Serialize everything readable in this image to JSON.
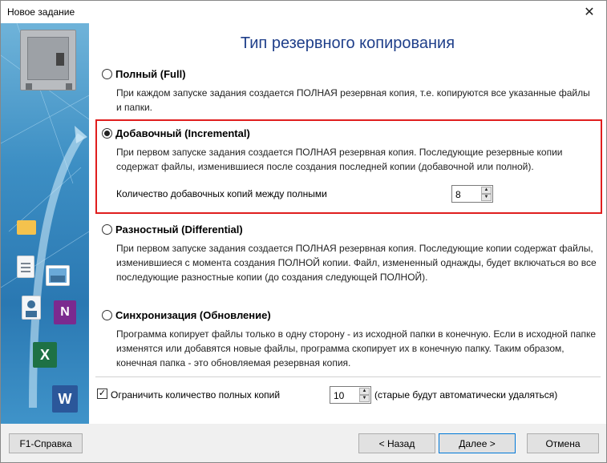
{
  "window": {
    "title": "Новое задание"
  },
  "heading": "Тип резервного копирования",
  "options": [
    {
      "label": "Полный (Full)",
      "description": "При каждом запуске задания создается ПОЛНАЯ резервная копия, т.е. копируются все указанные файлы и папки.",
      "selected": false
    },
    {
      "label": "Добавочный (Incremental)",
      "description": "При первом запуске задания создается ПОЛНАЯ резервная копия. Последующие резервные копии содержат файлы, изменившиеся после создания последней копии (добавочной или полной).",
      "selected": true
    },
    {
      "label": "Разностный (Differential)",
      "description": "При первом запуске задания создается ПОЛНАЯ резервная копия. Последующие копии содержат файлы, изменившиеся с момента создания ПОЛНОЙ копии. Файл, измененный однажды, будет включаться во все последующие разностные копии (до создания следующей ПОЛНОЙ).",
      "selected": false
    },
    {
      "label": "Синхронизация (Обновление)",
      "description": "Программа копирует файлы только в одну сторону - из исходной папки в конечную. Если в исходной папке изменятся или добавятся новые файлы, программа скопирует их в конечную папку. Таким образом, конечная папка - это обновляемая резервная копия.",
      "selected": false
    }
  ],
  "incremental_count": {
    "label": "Количество добавочных копий между полными",
    "value": "8"
  },
  "limit_full": {
    "checked": true,
    "label": "Ограничить количество полных копий",
    "value": "10",
    "hint": "(старые будут автоматически удаляться)"
  },
  "buttons": {
    "help": "F1-Справка",
    "back": "< Назад",
    "next": "Далее >",
    "cancel": "Отмена"
  },
  "colors": {
    "heading": "#1f3f8a",
    "highlight": "#e01e1e",
    "sidebar": "#3d8fc4"
  },
  "icons": [
    "safe-icon",
    "folder-icon",
    "document-icon",
    "image-icon",
    "contact-icon",
    "onenote-icon",
    "excel-icon",
    "word-icon"
  ]
}
